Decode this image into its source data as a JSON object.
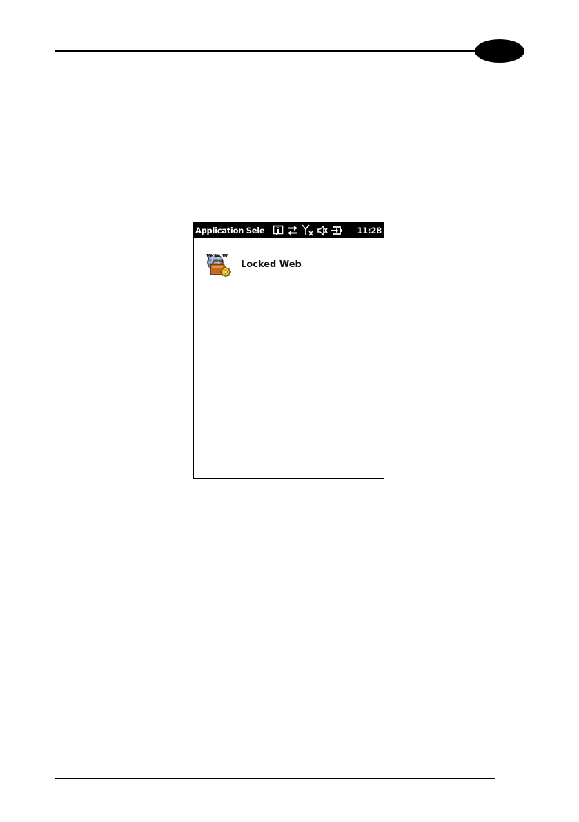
{
  "statusbar": {
    "title": "Application Sele",
    "time": "11:28"
  },
  "apps": [
    {
      "label": "Locked Web",
      "icon": "locked-web-icon"
    }
  ],
  "colors": {
    "statusbar_bg": "#000000",
    "statusbar_fg": "#ffffff"
  }
}
